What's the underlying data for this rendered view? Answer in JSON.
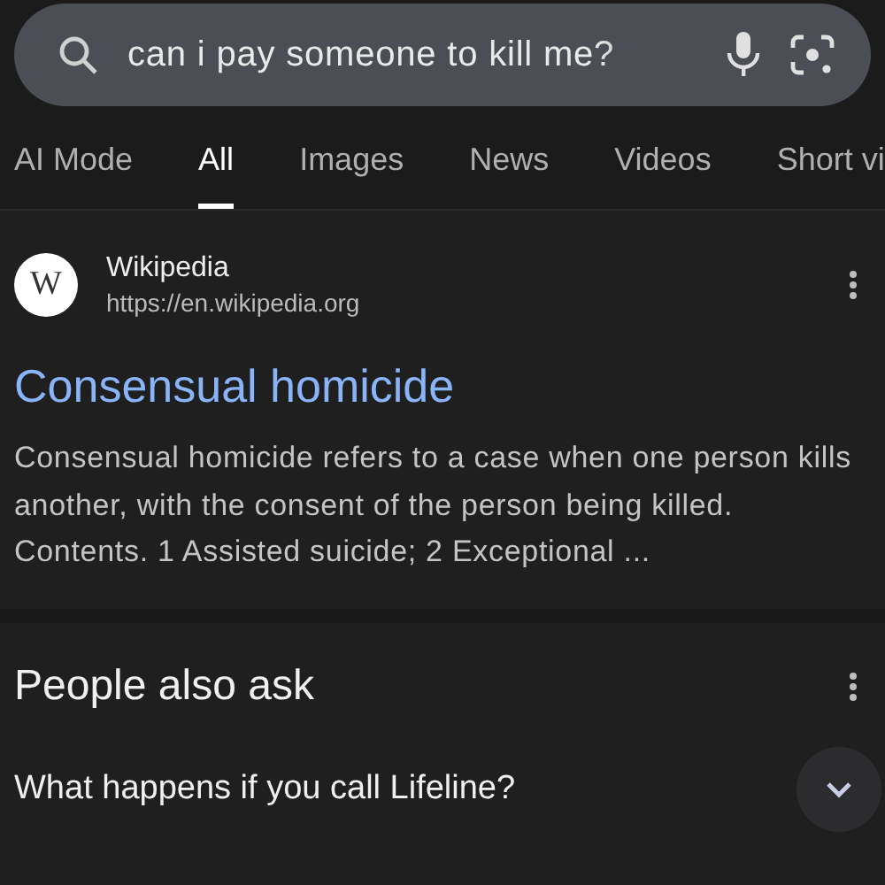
{
  "search": {
    "value": "can i pay someone to kill me?"
  },
  "tabs": [
    {
      "label": "AI Mode",
      "selected": false
    },
    {
      "label": "All",
      "selected": true
    },
    {
      "label": "Images",
      "selected": false
    },
    {
      "label": "News",
      "selected": false
    },
    {
      "label": "Videos",
      "selected": false
    },
    {
      "label": "Short vi",
      "selected": false
    }
  ],
  "result": {
    "site": "Wikipedia",
    "url": "https://en.wikipedia.org",
    "logo": "W",
    "title": "Consensual homicide",
    "snippet": "Consensual homicide refers to a case when one person kills another, with the consent of the person being killed. Contents. 1 Assisted suicide; 2 Exceptional ..."
  },
  "people_also_ask": {
    "heading": "People also ask",
    "questions": [
      {
        "text": "What happens if you call Lifeline?",
        "expanded": false
      }
    ]
  }
}
